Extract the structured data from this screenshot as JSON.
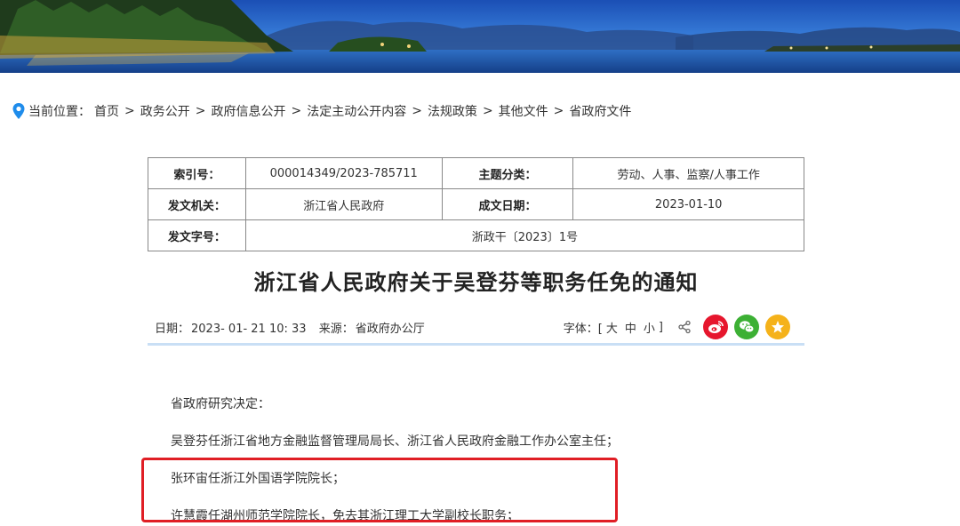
{
  "breadcrumb": {
    "prefix": "当前位置：",
    "items": [
      "首页",
      "政务公开",
      "政府信息公开",
      "法定主动公开内容",
      "法规政策",
      "其他文件",
      "省政府文件"
    ],
    "separator": ">"
  },
  "meta": {
    "index_label": "索引号：",
    "index_value": "000014349/2023-785711",
    "topic_label": "主题分类：",
    "topic_value": "劳动、人事、监察/人事工作",
    "issuer_label": "发文机关：",
    "issuer_value": "浙江省人民政府",
    "date_label": "成文日期：",
    "date_value": "2023-01-10",
    "docno_label": "发文字号：",
    "docno_value": "浙政干〔2023〕1号"
  },
  "title": "浙江省人民政府关于吴登芬等职务任免的通知",
  "info": {
    "date_label": "日期：",
    "date_value": "2023- 01- 21 10: 33",
    "source_label": "来源：",
    "source_value": "省政府办公厅",
    "font_label": "字体：[",
    "font_large": "大",
    "font_medium": "中",
    "font_small": "小",
    "font_close": "]"
  },
  "body": {
    "lines": [
      "省政府研究决定：",
      "吴登芬任浙江省地方金融监督管理局局长、浙江省人民政府金融工作办公室主任；",
      "张环宙任浙江外国语学院院长；",
      "许慧霞任湖州师范学院院长，免去其浙江理工大学副校长职务；"
    ]
  },
  "colors": {
    "weibo": "#e6162d",
    "wechat": "#3cb034",
    "favorite": "#f5b21a",
    "highlight": "#e01e25",
    "pin": "#1f8ceb"
  },
  "icons": [
    "location-pin-icon",
    "share-icon",
    "weibo-icon",
    "wechat-icon",
    "favorite-icon"
  ]
}
